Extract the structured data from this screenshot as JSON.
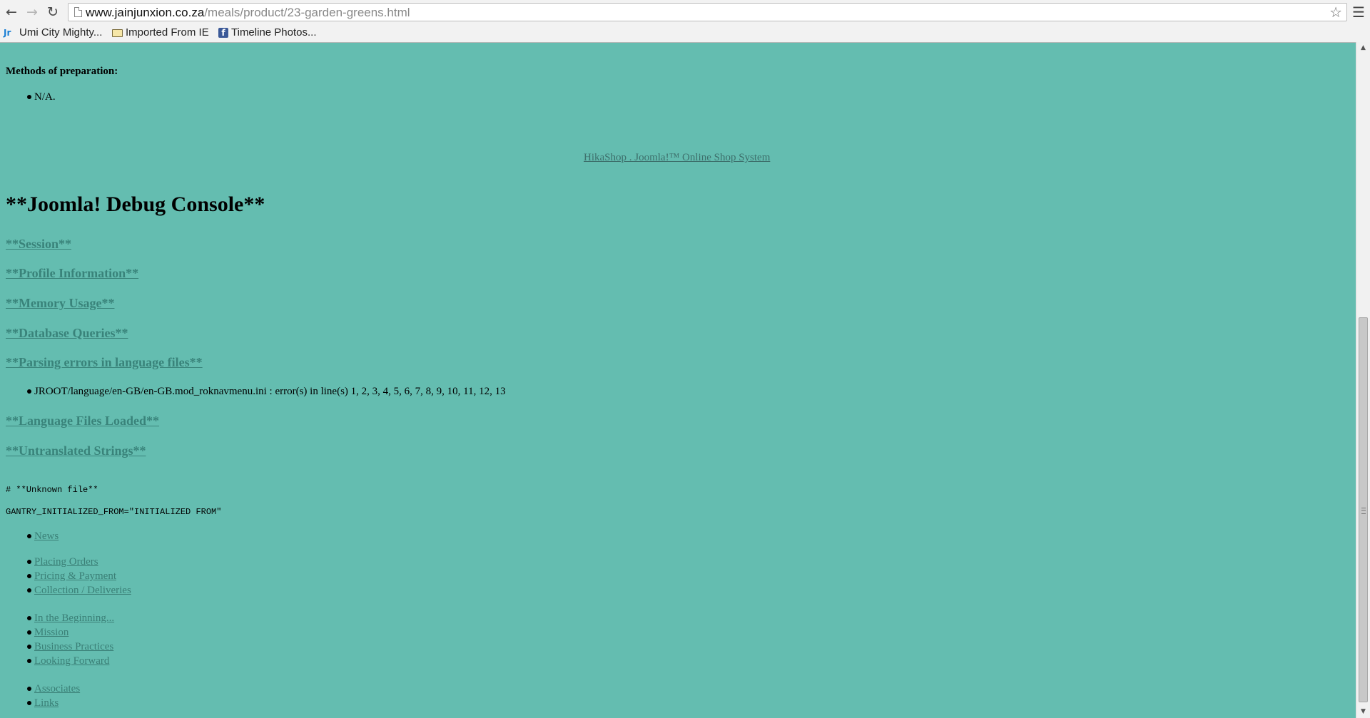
{
  "browser": {
    "nav": {
      "back_icon": "back-arrow-icon",
      "forward_icon": "forward-arrow-icon",
      "reload_icon": "reload-icon"
    },
    "address": {
      "host": "www.jainjunxion.co.za",
      "path": "/meals/product/23-garden-greens.html"
    },
    "bookmarks": [
      {
        "label": "Umi City Mighty...",
        "icon": "jr-logo-icon"
      },
      {
        "label": "Imported From IE",
        "icon": "folder-icon"
      },
      {
        "label": "Timeline Photos...",
        "icon": "facebook-icon"
      }
    ]
  },
  "page": {
    "methods_heading": "Methods of preparation:",
    "methods_items": [
      "N/A."
    ],
    "hikashop_link": "HikaShop . Joomla!™ Online Shop System",
    "debug_title": "**Joomla! Debug Console**",
    "debug_links": {
      "session": "**Session**",
      "profile": "**Profile Information**",
      "memory": "**Memory Usage**",
      "database": "**Database Queries**",
      "parsing": "**Parsing errors in language files**",
      "language_files": "**Language Files Loaded**",
      "untranslated": "**Untranslated Strings**"
    },
    "parsing_errors": [
      "JROOT/language/en-GB/en-GB.mod_roknavmenu.ini : error(s) in line(s) 1, 2, 3, 4, 5, 6, 7, 8, 9, 10, 11, 12, 13"
    ],
    "unknown_file": "# **Unknown file**",
    "gantry_line": "GANTRY_INITIALIZED_FROM=\"INITIALIZED FROM\"",
    "menu_groups": [
      [
        "News"
      ],
      [
        "Placing Orders",
        "Pricing & Payment",
        "Collection / Deliveries"
      ],
      [
        "In the Beginning...",
        "Mission",
        "Business Practices",
        "Looking Forward"
      ],
      [
        "Associates",
        "Links"
      ]
    ]
  },
  "colors": {
    "page_background": "#64bdb0",
    "link": "#3a7f76",
    "heading": "#000000"
  }
}
